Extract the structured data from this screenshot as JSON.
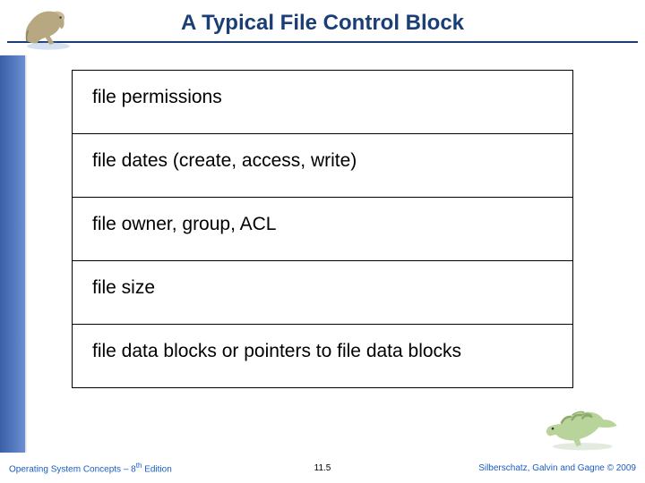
{
  "title": "A Typical File Control Block",
  "fcb_rows": [
    "file permissions",
    "file dates (create, access, write)",
    "file owner, group, ACL",
    "file size",
    "file data blocks or pointers to file data blocks"
  ],
  "footer": {
    "left_prefix": "Operating System Concepts – 8",
    "left_sup": "th",
    "left_suffix": " Edition",
    "center": "11.5",
    "right": "Silberschatz, Galvin and Gagne © 2009"
  }
}
